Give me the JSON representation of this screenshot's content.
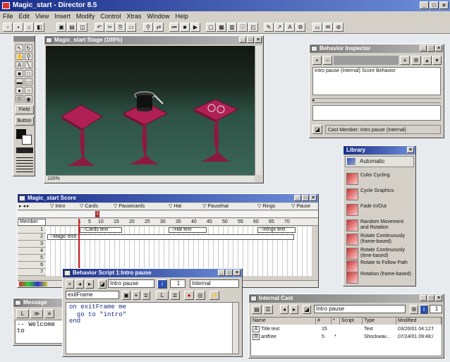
{
  "app": {
    "title": "Magic_start - Director 8.5"
  },
  "menu": [
    "File",
    "Edit",
    "View",
    "Insert",
    "Modify",
    "Control",
    "Xtras",
    "Window",
    "Help"
  ],
  "stage": {
    "title": "Magic_start Stage (100%)",
    "zoom": "100%"
  },
  "tools": {
    "field_label": "Field",
    "button_label": "Button"
  },
  "behavior_inspector": {
    "title": "Behavior Inspector",
    "list_item": "Intro pause (Internal) Score Behavior",
    "cast_member": "Cast Member:  Intro pause (Internal)"
  },
  "library": {
    "title": "Library",
    "category": "Automatic",
    "items": [
      "Color Cycling",
      "Cycle Graphics",
      "Fade In/Out",
      "Random Movement and Rotation",
      "Rotate Continuously (frame-based)",
      "Rotate Continuously (time-based)",
      "Rotate to Follow Path",
      "Rotation (frame-based)"
    ]
  },
  "score": {
    "title": "Magic_start Score",
    "markers": [
      "Intro",
      "Cards",
      "Pausecards",
      "Hat",
      "Pausehat",
      "Rings",
      "Pause"
    ],
    "frame_numbers": [
      "1",
      "5",
      "10",
      "15",
      "20",
      "25",
      "30",
      "35",
      "40",
      "45",
      "50",
      "55",
      "60",
      "65",
      "70"
    ],
    "member_label": "Member",
    "channels": [
      "1",
      "2",
      "3",
      "4",
      "5",
      "6",
      "7"
    ],
    "sprites": [
      "Cards text",
      "Hat text",
      "Rings text",
      "Magic trick"
    ]
  },
  "behavior_script": {
    "title": "Behavior Script 1:Intro pause",
    "name": "Intro pause",
    "number": "1",
    "type": "Internal",
    "handler": "exitFrame",
    "code": [
      "on exitFrame me",
      "  go to \"intro\"",
      "end"
    ]
  },
  "message": {
    "title": "Message",
    "text": "-- Welcome to"
  },
  "cast": {
    "title": "Internal Cast",
    "name": "Intro pause",
    "number": "1",
    "columns": [
      "Name",
      "#",
      "*",
      "Script",
      "Type",
      "Modified"
    ],
    "rows": [
      {
        "name": "Title text",
        "num": "15",
        "star": "",
        "script": "",
        "type": "Text",
        "modified": "03/20/01 04:12:f"
      },
      {
        "name": "antfree",
        "num": "5",
        "star": "*",
        "script": "",
        "type": "Shockwav...",
        "modified": "07/24/01 09:48:/"
      }
    ]
  },
  "colors": {
    "accent": "#1a2e8a",
    "playhead": "#cc2222",
    "table": "#b02055"
  }
}
